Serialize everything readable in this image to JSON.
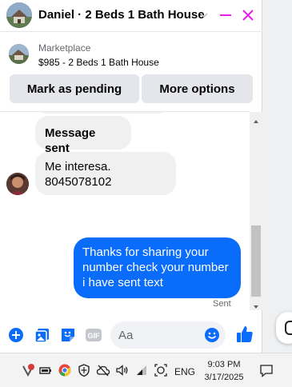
{
  "header": {
    "title": "Daniel · 2 Beds 1 Bath House"
  },
  "listing": {
    "source": "Marketplace",
    "description": "$985 - 2 Beds 1 Bath House"
  },
  "actions": {
    "mark_pending": "Mark as pending",
    "more_options": "More options"
  },
  "messages": {
    "incoming": [
      {
        "text": "Message sent"
      },
      {
        "line1": "Me interesa.",
        "line2": "8045078102"
      }
    ],
    "outgoing": {
      "line1": "Thanks for sharing your",
      "line2": "number check your number",
      "line3": "i have sent text"
    },
    "status": "Sent"
  },
  "composer": {
    "placeholder": "Aa",
    "gif_label": "GIF"
  },
  "taskbar": {
    "language": "ENG",
    "time": "9:03 PM",
    "date": "3/17/2025"
  },
  "colors": {
    "accent": "#0a6cfb",
    "brand_pink": "#e81ee6",
    "bubble_in": "#f0f0f0"
  }
}
